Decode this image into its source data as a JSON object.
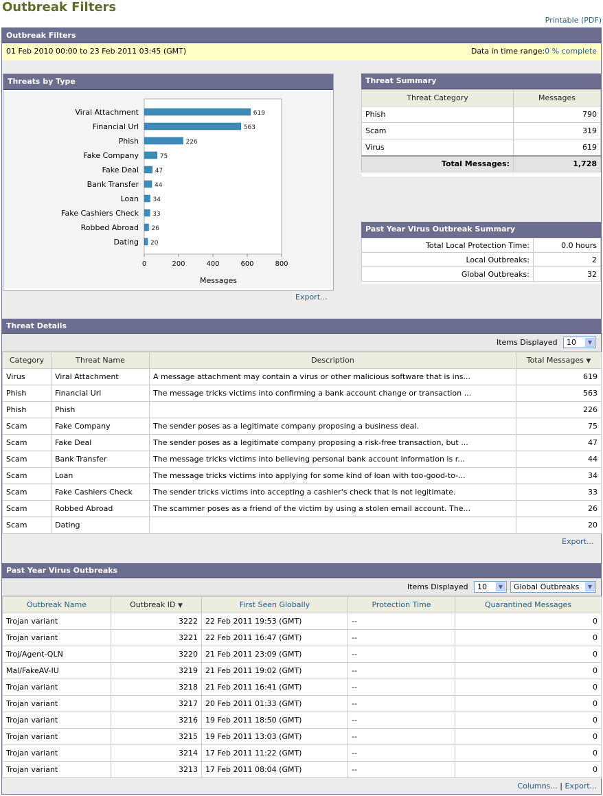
{
  "page": {
    "title": "Outbreak Filters",
    "printable_link": "Printable (PDF)"
  },
  "outer_header": "Outbreak Filters",
  "time_range": {
    "range_text": "01 Feb 2010 00:00 to 23 Feb 2011 03:45 (GMT)",
    "data_label": "Data in time range:",
    "data_value": "0 % complete"
  },
  "threats_by_type": {
    "header": "Threats by Type",
    "export_label": "Export...",
    "chart_data": {
      "type": "bar",
      "orientation": "horizontal",
      "categories": [
        "Viral Attachment",
        "Financial Url",
        "Phish",
        "Fake Company",
        "Fake Deal",
        "Bank Transfer",
        "Loan",
        "Fake Cashiers Check",
        "Robbed Abroad",
        "Dating"
      ],
      "values": [
        619,
        563,
        226,
        75,
        47,
        44,
        34,
        33,
        26,
        20
      ],
      "xlabel": "Messages",
      "ylabel": "",
      "xlim": [
        0,
        800
      ],
      "ticks": [
        "0",
        "200",
        "400",
        "600",
        "800"
      ],
      "bar_color": "#3f8bb8",
      "grid": false
    }
  },
  "threat_summary": {
    "header": "Threat Summary",
    "col_category": "Threat Category",
    "col_messages": "Messages",
    "rows": [
      {
        "category": "Phish",
        "messages": "790"
      },
      {
        "category": "Scam",
        "messages": "319"
      },
      {
        "category": "Virus",
        "messages": "619"
      }
    ],
    "total_label": "Total Messages:",
    "total_value": "1,728"
  },
  "virus_summary": {
    "header": "Past Year Virus Outbreak Summary",
    "rows": [
      {
        "label": "Total Local Protection Time:",
        "value": "0.0 hours"
      },
      {
        "label": "Local Outbreaks:",
        "value": "2"
      },
      {
        "label": "Global Outbreaks:",
        "value": "32"
      }
    ]
  },
  "threat_details": {
    "header": "Threat Details",
    "items_label": "Items Displayed",
    "items_value": "10",
    "columns": [
      "Category",
      "Threat Name",
      "Description",
      "Total Messages"
    ],
    "rows": [
      {
        "category": "Virus",
        "name": "Viral Attachment",
        "description": "A message attachment may contain a virus or other malicious software that is ins...",
        "total": "619"
      },
      {
        "category": "Phish",
        "name": "Financial Url",
        "description": "The message tricks victims into confirming a bank account change or transaction ...",
        "total": "563"
      },
      {
        "category": "Phish",
        "name": "Phish",
        "description": "",
        "total": "226"
      },
      {
        "category": "Scam",
        "name": "Fake Company",
        "description": "The sender poses as a legitimate company proposing a business deal.",
        "total": "75"
      },
      {
        "category": "Scam",
        "name": "Fake Deal",
        "description": "The sender poses as a legitimate company proposing a risk-free transaction, but ...",
        "total": "47"
      },
      {
        "category": "Scam",
        "name": "Bank Transfer",
        "description": "The message tricks victims into believing personal bank account information is r...",
        "total": "44"
      },
      {
        "category": "Scam",
        "name": "Loan",
        "description": "The message tricks victims into applying for some kind of loan with too-good-to-...",
        "total": "34"
      },
      {
        "category": "Scam",
        "name": "Fake Cashiers Check",
        "description": "The sender tricks victims into accepting a cashier's check that is not legitimate.",
        "total": "33"
      },
      {
        "category": "Scam",
        "name": "Robbed Abroad",
        "description": "The scammer poses as a friend of the victim by using a stolen email account. The...",
        "total": "26"
      },
      {
        "category": "Scam",
        "name": "Dating",
        "description": "",
        "total": "20"
      }
    ],
    "export_label": "Export..."
  },
  "virus_outbreaks": {
    "header": "Past Year Virus Outbreaks",
    "items_label": "Items Displayed",
    "items_value": "10",
    "scope_value": "Global Outbreaks",
    "columns": [
      "Outbreak Name",
      "Outbreak ID",
      "First Seen Globally",
      "Protection Time",
      "Quarantined Messages"
    ],
    "rows": [
      {
        "name": "Trojan variant",
        "id": "3222",
        "first_seen": "22 Feb 2011 19:53 (GMT)",
        "protection": "--",
        "quarantined": "0"
      },
      {
        "name": "Trojan variant",
        "id": "3221",
        "first_seen": "22 Feb 2011 16:47 (GMT)",
        "protection": "--",
        "quarantined": "0"
      },
      {
        "name": "Troj/Agent-QLN",
        "id": "3220",
        "first_seen": "21 Feb 2011 23:09 (GMT)",
        "protection": "--",
        "quarantined": "0"
      },
      {
        "name": "Mal/FakeAV-IU",
        "id": "3219",
        "first_seen": "21 Feb 2011 19:02 (GMT)",
        "protection": "--",
        "quarantined": "0"
      },
      {
        "name": "Trojan variant",
        "id": "3218",
        "first_seen": "21 Feb 2011 16:41 (GMT)",
        "protection": "--",
        "quarantined": "0"
      },
      {
        "name": "Trojan variant",
        "id": "3217",
        "first_seen": "20 Feb 2011 01:33 (GMT)",
        "protection": "--",
        "quarantined": "0"
      },
      {
        "name": "Trojan variant",
        "id": "3216",
        "first_seen": "19 Feb 2011 18:50 (GMT)",
        "protection": "--",
        "quarantined": "0"
      },
      {
        "name": "Trojan variant",
        "id": "3215",
        "first_seen": "19 Feb 2011 13:03 (GMT)",
        "protection": "--",
        "quarantined": "0"
      },
      {
        "name": "Trojan variant",
        "id": "3214",
        "first_seen": "17 Feb 2011 11:22 (GMT)",
        "protection": "--",
        "quarantined": "0"
      },
      {
        "name": "Trojan variant",
        "id": "3213",
        "first_seen": "17 Feb 2011 08:04 (GMT)",
        "protection": "--",
        "quarantined": "0"
      }
    ],
    "columns_label": "Columns...",
    "separator": "|",
    "export_label": "Export..."
  }
}
